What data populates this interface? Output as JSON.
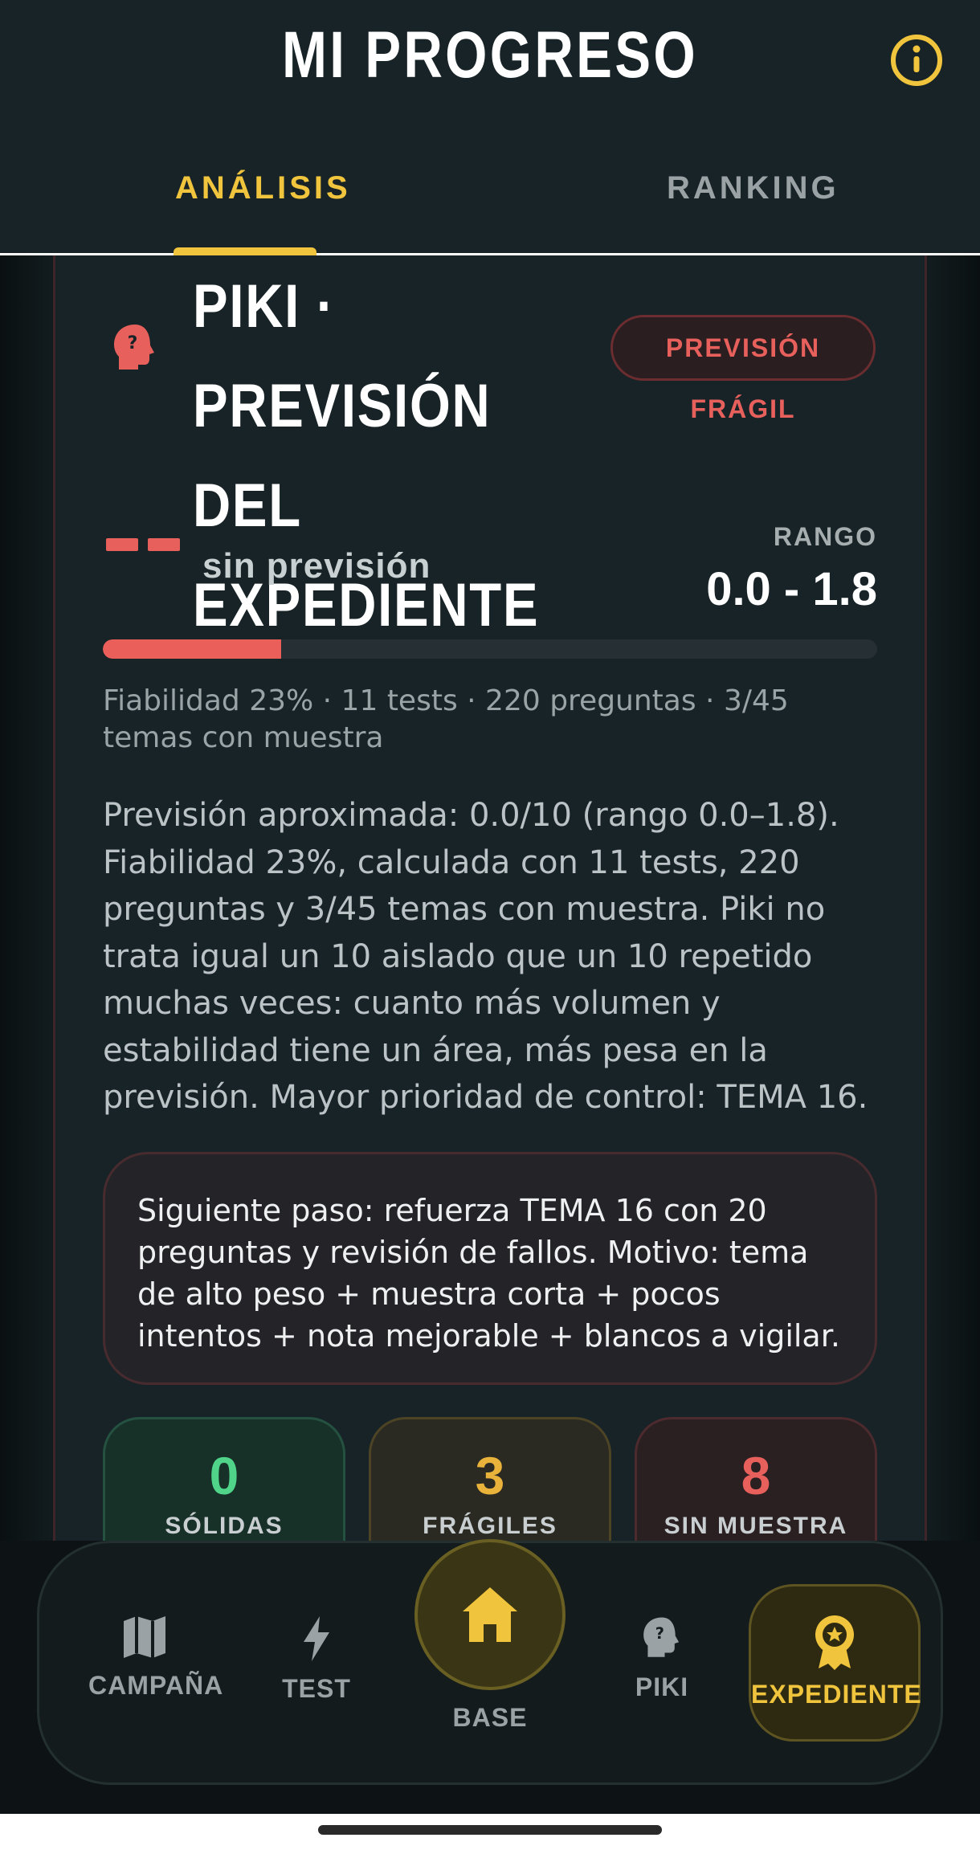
{
  "header": {
    "title": "MI PROGRESO",
    "tabs": [
      {
        "label": "ANÁLISIS",
        "active": true
      },
      {
        "label": "RANKING",
        "active": false
      }
    ]
  },
  "card": {
    "title_line1": "PIKI · PREVISIÓN",
    "title_line2": "DEL EXPEDIENTE",
    "badge": "PREVISIÓN FRÁGIL",
    "forecast_value": "--",
    "forecast_text": "sin previsión",
    "range_label": "RANGO",
    "range_value": "0.0 - 1.8",
    "reliability_fraction": 0.23,
    "meta": "Fiabilidad 23% · 11 tests · 220 preguntas · 3/45 temas con muestra",
    "description": "Previsión aproximada: 0.0/10 (rango 0.0–1.8). Fiabilidad 23%, calculada con 11 tests, 220 preguntas y 3/45 temas con muestra. Piki no trata igual un 10 aislado que un 10 repetido muchas veces: cuanto más volumen y estabilidad tiene un área, más pesa en la previsión. Mayor prioridad de control: TEMA 16.",
    "next_step": "Siguiente paso: refuerza TEMA 16 con 20 preguntas y revisión de fallos. Motivo: tema de alto peso + muestra corta + pocos intentos + nota mejorable + blancos a vigilar.",
    "stats": [
      {
        "value": "0",
        "label": "SÓLIDAS",
        "color": "#4fd48a"
      },
      {
        "value": "3",
        "label": "FRÁGILES",
        "color": "#e9b23a"
      },
      {
        "value": "8",
        "label": "SIN MUESTRA",
        "color": "#e8605c"
      }
    ]
  },
  "nav": {
    "items": [
      {
        "label": "CAMPAÑA",
        "icon": "map-icon"
      },
      {
        "label": "TEST",
        "icon": "lightning-icon"
      },
      {
        "label": "BASE",
        "icon": "home-icon"
      },
      {
        "label": "PIKI",
        "icon": "question-head-icon"
      },
      {
        "label": "EXPEDIENTE",
        "icon": "award-icon",
        "active": true
      }
    ]
  },
  "colors": {
    "accent": "#f0c43c",
    "danger": "#e8605c",
    "success": "#4fd48a",
    "warning": "#e9b23a"
  }
}
